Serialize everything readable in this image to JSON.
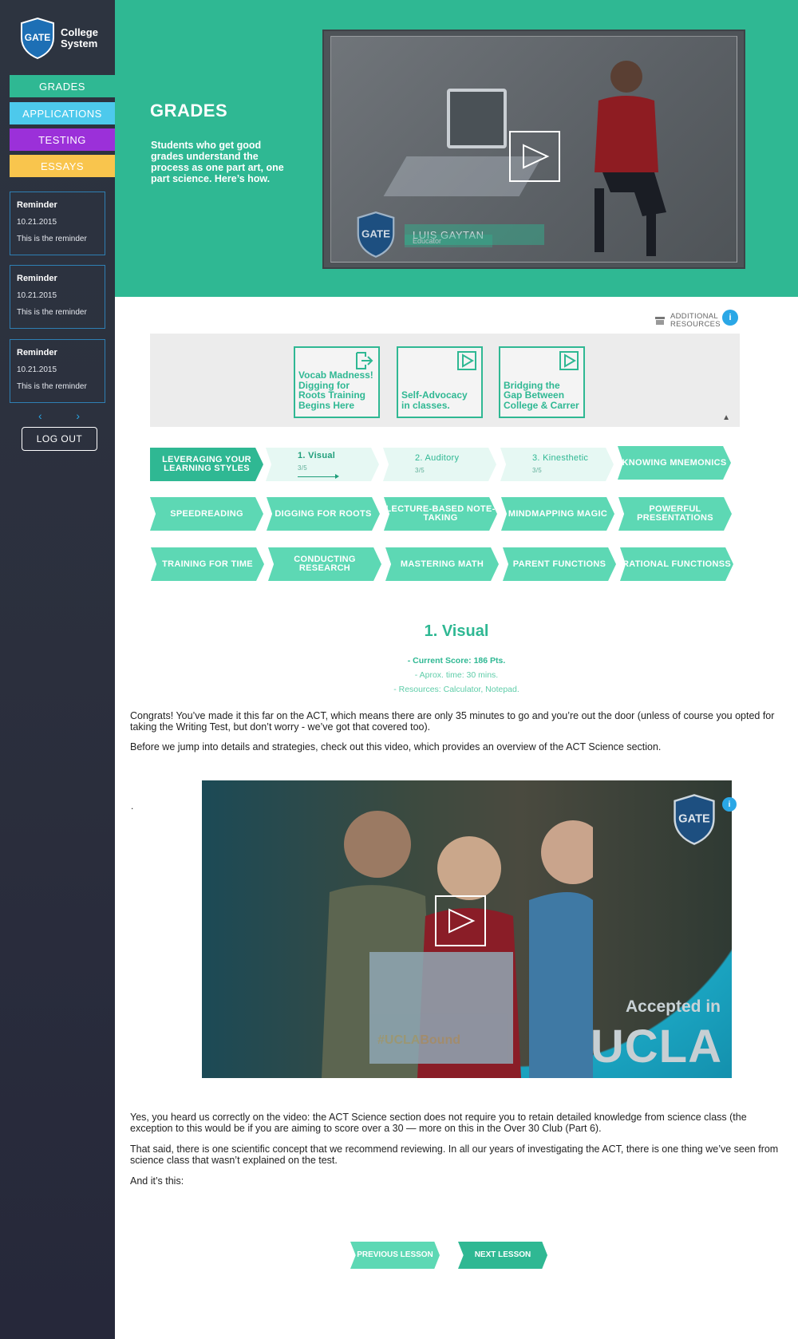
{
  "sidebar": {
    "logo_word": "GATE",
    "logo_line1": "College",
    "logo_line2": "System",
    "collapse_glyph": "⇤",
    "settings_glyph": "⎋",
    "nav": [
      {
        "label": "GRADES",
        "color": "#2fb893"
      },
      {
        "label": "APPLICATIONS",
        "color": "#4dc9ec"
      },
      {
        "label": "TESTING",
        "color": "#9b30d9"
      },
      {
        "label": "ESSAYS",
        "color": "#f9c54d"
      }
    ],
    "reminders": [
      {
        "title": "Reminder",
        "date": "10.21.2015",
        "text": "This is the reminder"
      },
      {
        "title": "Reminder",
        "date": "10.21.2015",
        "text": "This is the reminder"
      },
      {
        "title": "Reminder",
        "date": "10.21.2015",
        "text": "This is the reminder"
      }
    ],
    "pager_prev": "‹",
    "pager_next": "›",
    "logout_label": "LOG OUT"
  },
  "hero": {
    "title": "GRADES",
    "description": "Students who get good grades understand the process as one part art, one part science. Here’s how.",
    "video": {
      "logo_word": "GATE",
      "presenter_name": "LUIS GAYTAN",
      "presenter_role": "Educator"
    }
  },
  "resources": {
    "label_line1": "ADDITIONAL",
    "label_line2": "RESOURCES",
    "info_glyph": "i",
    "cards": [
      {
        "label": "Vocab Madness! Digging for Roots Training Begins Here",
        "icon": "external-link-icon"
      },
      {
        "label": "Self-Advocacy in classes.",
        "icon": "play-icon"
      },
      {
        "label": "Bridging the Gap Between College & Carrer",
        "icon": "play-icon"
      }
    ],
    "caret": "▲"
  },
  "lessons": {
    "row1": [
      {
        "label": "LEVERAGING YOUR LEARNING STYLES"
      },
      {
        "label": "1. Visual",
        "sub": "3/5"
      },
      {
        "label": "2. Auditory",
        "sub": "3/5"
      },
      {
        "label": "3. Kinesthetic",
        "sub": "3/5"
      },
      {
        "label": "KNOWING MNEMONICS"
      }
    ],
    "row2": [
      "SPEEDREADING",
      "DIGGING FOR ROOTS",
      "LECTURE-BASED NOTE-TAKING",
      "MINDMAPPING MAGIC",
      "POWERFUL PRESENTATIONS"
    ],
    "row3": [
      "TRAINING FOR TIME",
      "CONDUCTING RESEARCH",
      "MASTERING MATH",
      "PARENT FUNCTIONS",
      "RATIONAL FUNCTIONSS"
    ]
  },
  "content": {
    "title": "1. Visual",
    "score": "- Current Score: 186 Pts.",
    "time": "- Aprox. time: 30 mins.",
    "resources": "- Resources: Calculator, Notepad.",
    "para1": "Congrats! You’ve made it this far on the ACT, which means there are only 35 minutes to go and you’re out the door (unless of course you opted for taking the Writing Test, but don’t worry - we’ve got that covered too).",
    "para2": "Before we jump into details and strategies, check out this video, which provides an overview of the ACT Science section.",
    "dot": ".",
    "video": {
      "logo_word": "GATE",
      "info_glyph": "i",
      "sign_text": "#UCLABound",
      "accepted": "Accepted in",
      "school": "UCLA"
    },
    "para3": "Yes, you heard us correctly on the video: the ACT Science section does not require you to retain detailed knowledge from science class (the exception to this would be if you are aiming to score over a 30 — more on this in the Over 30 Club (Part 6).",
    "para4": "That said, there is one scientific concept that we recommend reviewing.  In all our years of investigating the ACT, there is one thing we’ve seen from science class that wasn’t explained on the test.",
    "para5": "And it’s this:",
    "prev_label": "PREVIOUS LESSON",
    "next_label": "NEXT LESSON"
  },
  "colors": {
    "accent": "#2fb893",
    "accent_light": "#5dd8b4",
    "info_blue": "#2aa7e6"
  }
}
